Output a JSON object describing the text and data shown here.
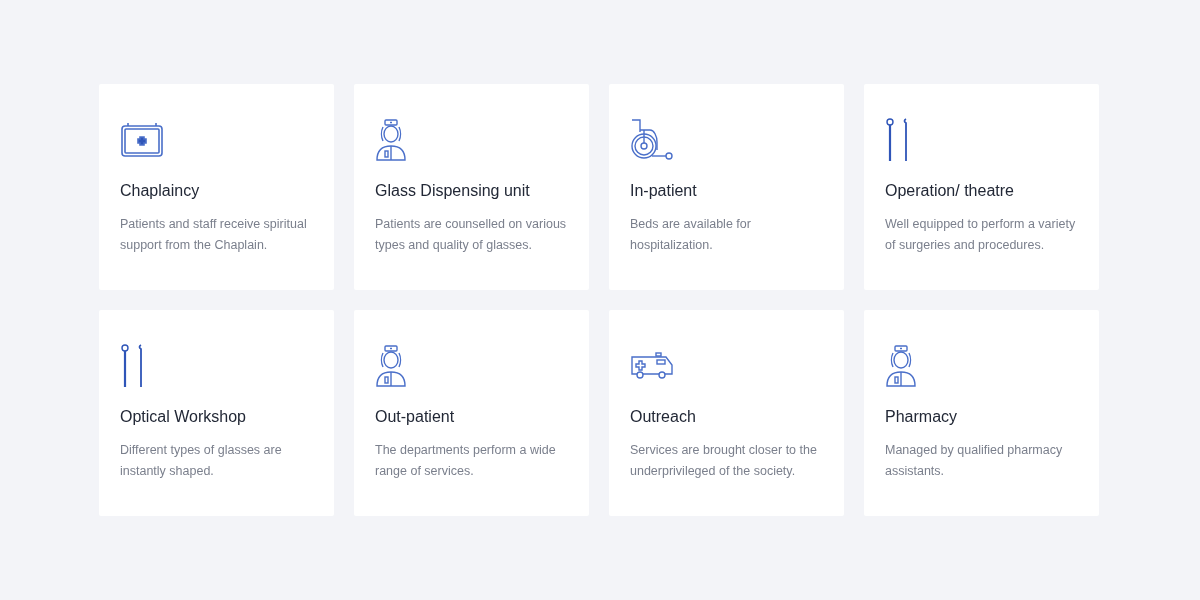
{
  "services": [
    {
      "kind": "kit",
      "title": "Chaplaincy",
      "description": "Patients and staff receive spiritual support from the Chaplain."
    },
    {
      "kind": "nurse",
      "title": "Glass Dispensing unit",
      "description": "Patients are counselled on various types and quality of glasses."
    },
    {
      "kind": "wheelchair",
      "title": "In-patient",
      "description": "Beds are available for hospitalization."
    },
    {
      "kind": "tools",
      "title": "Operation/ theatre",
      "description": "Well equipped to perform a variety of surgeries and procedures."
    },
    {
      "kind": "tools",
      "title": "Optical Workshop",
      "description": "Different types of glasses are instantly shaped."
    },
    {
      "kind": "nurse",
      "title": "Out-patient",
      "description": "The departments perform a wide range of services."
    },
    {
      "kind": "ambulance",
      "title": "Outreach",
      "description": "Services are brought closer to the underprivileged of the society."
    },
    {
      "kind": "nurse",
      "title": "Pharmacy",
      "description": "Managed by qualified pharmacy assistants."
    }
  ]
}
